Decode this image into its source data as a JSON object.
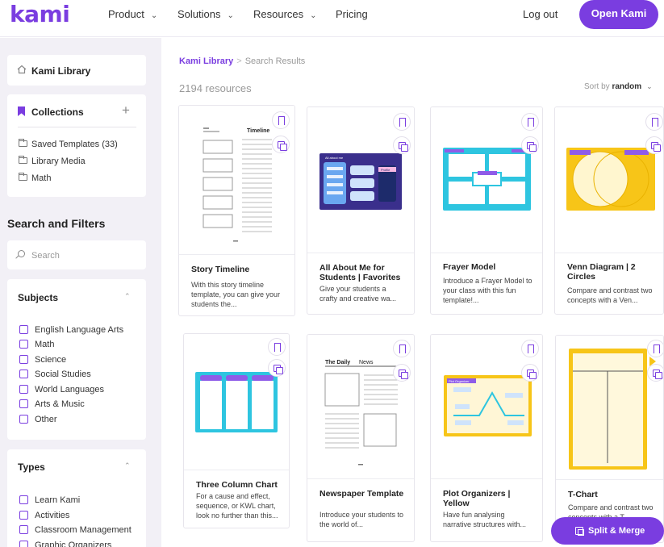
{
  "nav": {
    "logo": "kami",
    "items": [
      {
        "label": "Product"
      },
      {
        "label": "Solutions"
      },
      {
        "label": "Resources"
      },
      {
        "label": "Pricing"
      }
    ],
    "login": "Log out",
    "cta": "Open Kami"
  },
  "sidebar": {
    "library": "Kami Library",
    "collections": {
      "title": "Collections",
      "folders": [
        "Saved Templates (33)",
        "Library Media",
        "Math"
      ]
    },
    "search_title": "Search and Filters",
    "search_placeholder": "Search",
    "subjects": {
      "title": "Subjects",
      "items": [
        "English Language Arts",
        "Math",
        "Science",
        "Social Studies",
        "World Languages",
        "Arts & Music",
        "Other"
      ]
    },
    "types": {
      "title": "Types",
      "items": [
        "Learn Kami",
        "Activities",
        "Classroom Management",
        "Graphic Organizers"
      ]
    }
  },
  "main": {
    "breadcrumb": {
      "root": "Kami Library",
      "current": "Search Results"
    },
    "count": "2194 resources",
    "sort": {
      "prefix": "Sort by",
      "value": "random"
    },
    "cards": [
      {
        "title": "Story Timeline",
        "desc": "With this story timeline template, you can give your students the..."
      },
      {
        "title": "All About Me for Students | Favorites",
        "desc": "Give your students a crafty and creative wa..."
      },
      {
        "title": "Frayer Model",
        "desc": "Introduce a Frayer Model to your class with this fun template!..."
      },
      {
        "title": "Venn Diagram | 2 Circles",
        "desc": "Compare and contrast two concepts with a Ven..."
      },
      {
        "title": "Three Column Chart",
        "desc": "For a cause and effect, sequence, or KWL chart, look no further than this..."
      },
      {
        "title": "Newspaper Template",
        "desc": "Introduce your students to the world of..."
      },
      {
        "title": "Plot Organizers | Yellow",
        "desc": "Have fun analysing narrative structures with..."
      },
      {
        "title": "T-Chart",
        "desc": "Compare and contrast two concepts with a T..."
      }
    ],
    "thumb_text": {
      "timeline": "Timeline",
      "about_me": "All about me",
      "profile": "Profile",
      "daily_news_a": "The Daily",
      "daily_news_b": "News",
      "plot": "Plot Organizer"
    }
  },
  "fab": {
    "label": "Split & Merge"
  },
  "colors": {
    "brand": "#7a3de0",
    "sidebar_bg": "#f2f0f6"
  }
}
